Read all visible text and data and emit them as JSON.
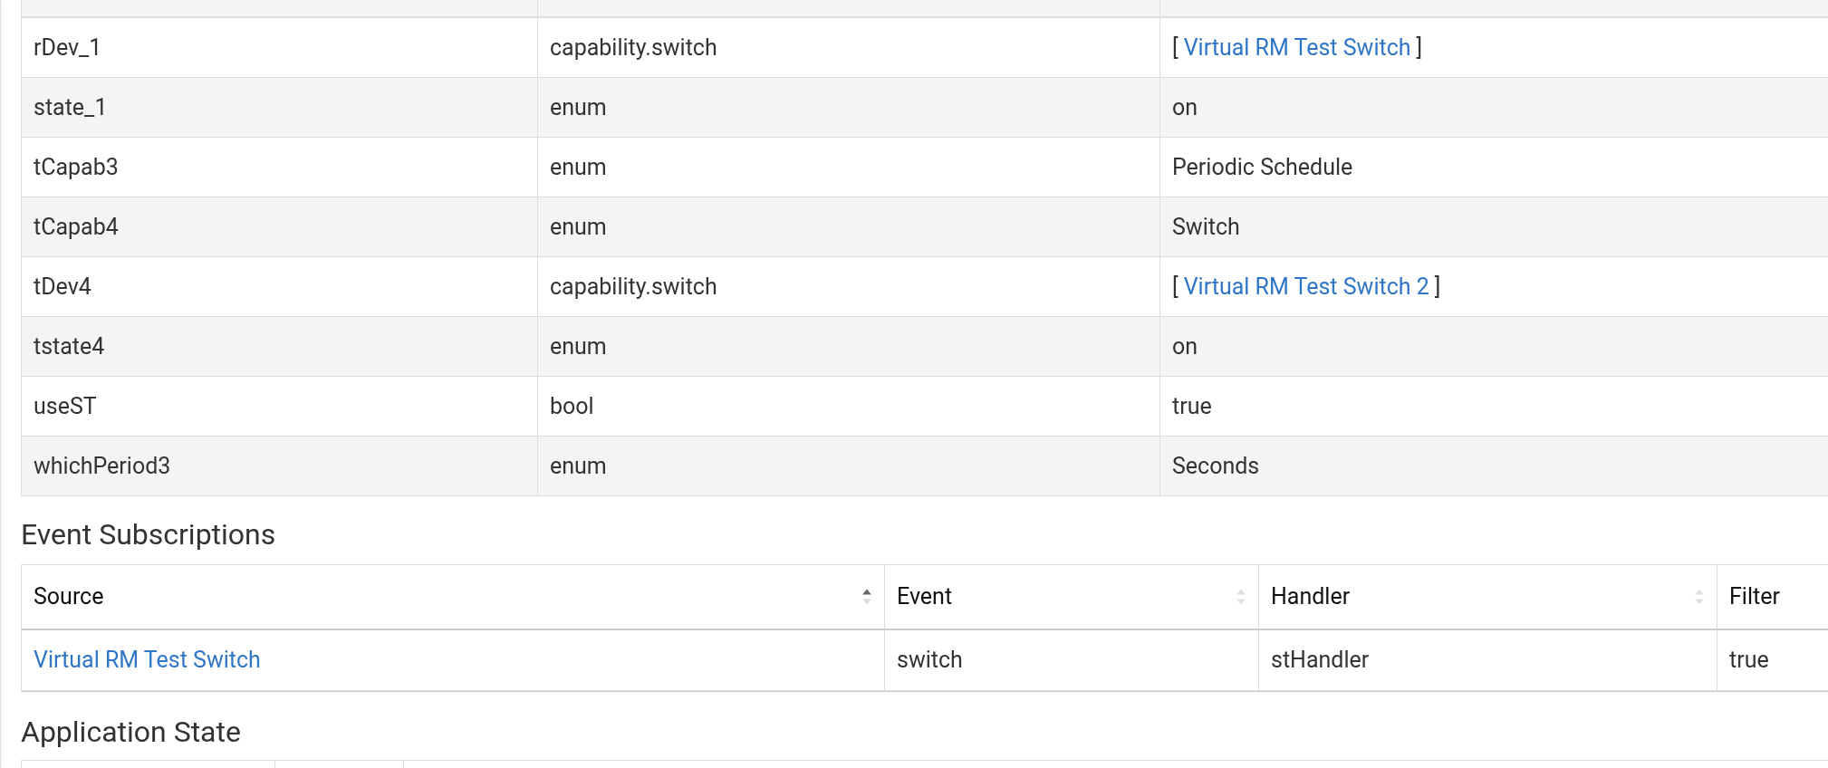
{
  "settings": {
    "rows": [
      {
        "name": "rDev_1",
        "type": "capability.switch",
        "value": {
          "kind": "link",
          "text": "Virtual RM Test Switch",
          "open": "[",
          "close": "]"
        }
      },
      {
        "name": "state_1",
        "type": "enum",
        "value": {
          "kind": "text",
          "text": "on"
        }
      },
      {
        "name": "tCapab3",
        "type": "enum",
        "value": {
          "kind": "text",
          "text": "Periodic Schedule"
        }
      },
      {
        "name": "tCapab4",
        "type": "enum",
        "value": {
          "kind": "text",
          "text": "Switch"
        }
      },
      {
        "name": "tDev4",
        "type": "capability.switch",
        "value": {
          "kind": "link",
          "text": "Virtual RM Test Switch 2",
          "open": "[",
          "close": "]"
        }
      },
      {
        "name": "tstate4",
        "type": "enum",
        "value": {
          "kind": "text",
          "text": "on"
        }
      },
      {
        "name": "useST",
        "type": "bool",
        "value": {
          "kind": "text",
          "text": "true"
        }
      },
      {
        "name": "whichPeriod3",
        "type": "enum",
        "value": {
          "kind": "text",
          "text": "Seconds"
        }
      }
    ]
  },
  "event_subscriptions": {
    "title": "Event Subscriptions",
    "columns": [
      {
        "label": "Source",
        "sorted": true
      },
      {
        "label": "Event",
        "sorted": false
      },
      {
        "label": "Handler",
        "sorted": false
      },
      {
        "label": "Filter"
      }
    ],
    "rows": [
      {
        "source": "Virtual RM Test Switch",
        "event": "switch",
        "handler": "stHandler",
        "filter": "true"
      }
    ]
  },
  "application_state": {
    "title": "Application State"
  }
}
